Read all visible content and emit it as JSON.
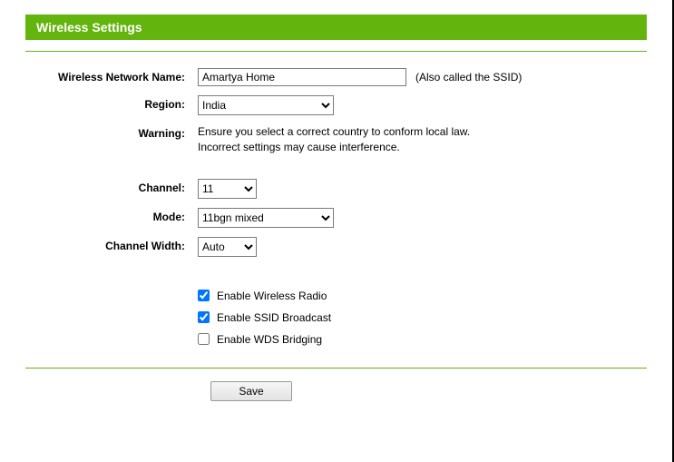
{
  "header": {
    "title": "Wireless Settings"
  },
  "fields": {
    "ssid": {
      "label": "Wireless Network Name:",
      "value": "Amartya Home",
      "hint": "(Also called the SSID)"
    },
    "region": {
      "label": "Region:",
      "value": "India"
    },
    "warning": {
      "label": "Warning:",
      "line1": "Ensure you select a correct country to conform local law.",
      "line2": "Incorrect settings may cause interference."
    },
    "channel": {
      "label": "Channel:",
      "value": "11"
    },
    "mode": {
      "label": "Mode:",
      "value": "11bgn mixed"
    },
    "channel_width": {
      "label": "Channel Width:",
      "value": "Auto"
    }
  },
  "checkboxes": {
    "wireless_radio": {
      "label": "Enable Wireless Radio",
      "checked": true
    },
    "ssid_broadcast": {
      "label": "Enable SSID Broadcast",
      "checked": true
    },
    "wds_bridging": {
      "label": "Enable WDS Bridging",
      "checked": false
    }
  },
  "buttons": {
    "save": "Save"
  }
}
